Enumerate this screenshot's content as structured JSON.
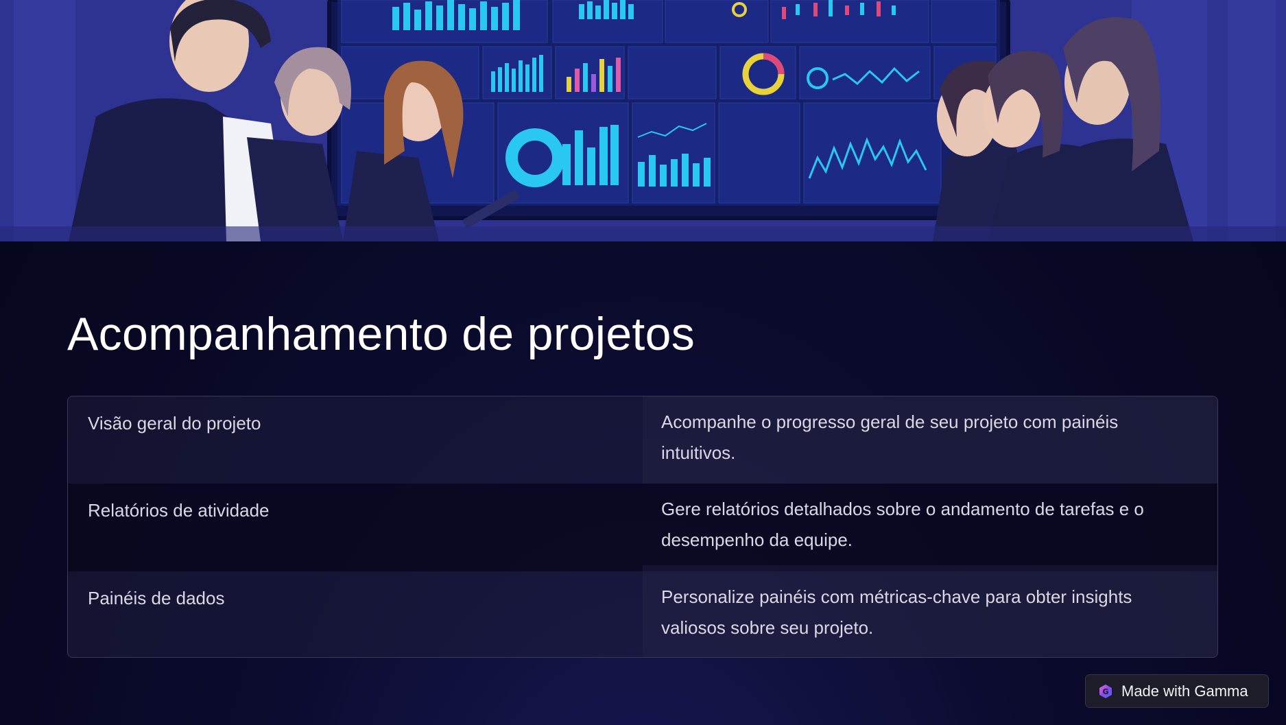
{
  "page": {
    "title": "Acompanhamento de projetos"
  },
  "hero": {
    "icon": "hero-illustration",
    "description_icon": "dashboard-team-illustration"
  },
  "table": {
    "rows": [
      {
        "label": "Visão geral do projeto",
        "description": "Acompanhe o progresso geral de seu projeto com painéis intuitivos."
      },
      {
        "label": "Relatórios de atividade",
        "description": "Gere relatórios detalhados sobre o andamento de tarefas e o desempenho da equipe."
      },
      {
        "label": "Painéis de dados",
        "description": "Personalize painéis com métricas-chave para obter insights valiosos sobre seu projeto."
      }
    ]
  },
  "badge": {
    "label": "Made with Gamma",
    "icon": "gamma-logo-icon"
  },
  "colors": {
    "background": "#05051a",
    "hero_blue": "#2c2f8a",
    "screen_accent": "#22c6f0",
    "text": "#d8d8e6"
  }
}
